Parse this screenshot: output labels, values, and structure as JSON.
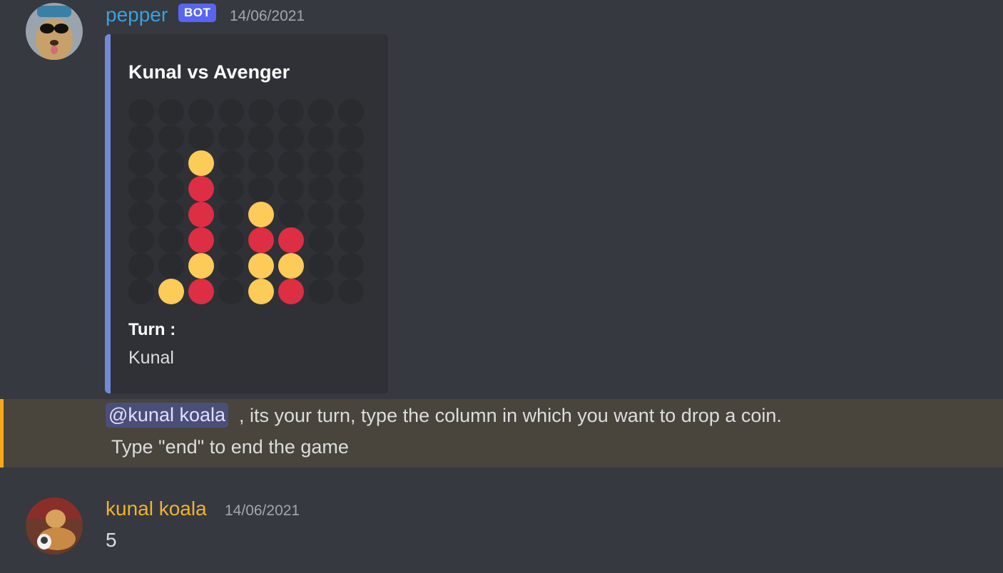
{
  "messages": [
    {
      "author": "pepper",
      "author_color": "#3aa0e0",
      "badge": "BOT",
      "timestamp": "14/06/2021",
      "embed": {
        "title": "Kunal vs Avenger",
        "accent_color": "#7289da",
        "field_name": "Turn :",
        "field_value": "Kunal",
        "board": {
          "rows": 8,
          "cols": 8,
          "empty_color": "#292b2f",
          "red_color": "#dd2e44",
          "yellow_color": "#fdcb58",
          "grid": [
            [
              "e",
              "e",
              "e",
              "e",
              "e",
              "e",
              "e",
              "e"
            ],
            [
              "e",
              "e",
              "e",
              "e",
              "e",
              "e",
              "e",
              "e"
            ],
            [
              "e",
              "e",
              "y",
              "e",
              "e",
              "e",
              "e",
              "e"
            ],
            [
              "e",
              "e",
              "r",
              "e",
              "e",
              "e",
              "e",
              "e"
            ],
            [
              "e",
              "e",
              "r",
              "e",
              "y",
              "e",
              "e",
              "e"
            ],
            [
              "e",
              "e",
              "r",
              "e",
              "r",
              "r",
              "e",
              "e"
            ],
            [
              "e",
              "e",
              "y",
              "e",
              "y",
              "y",
              "e",
              "e"
            ],
            [
              "e",
              "y",
              "r",
              "e",
              "y",
              "r",
              "e",
              "e"
            ]
          ]
        }
      },
      "mention": "@kunal koala",
      "text_line1": ", its your turn, type the column in which you want to drop a coin.",
      "text_line2": "Type \"end\" to end the game"
    },
    {
      "author": "kunal koala",
      "author_color": "#f0b232",
      "timestamp": "14/06/2021",
      "text": "5"
    }
  ]
}
